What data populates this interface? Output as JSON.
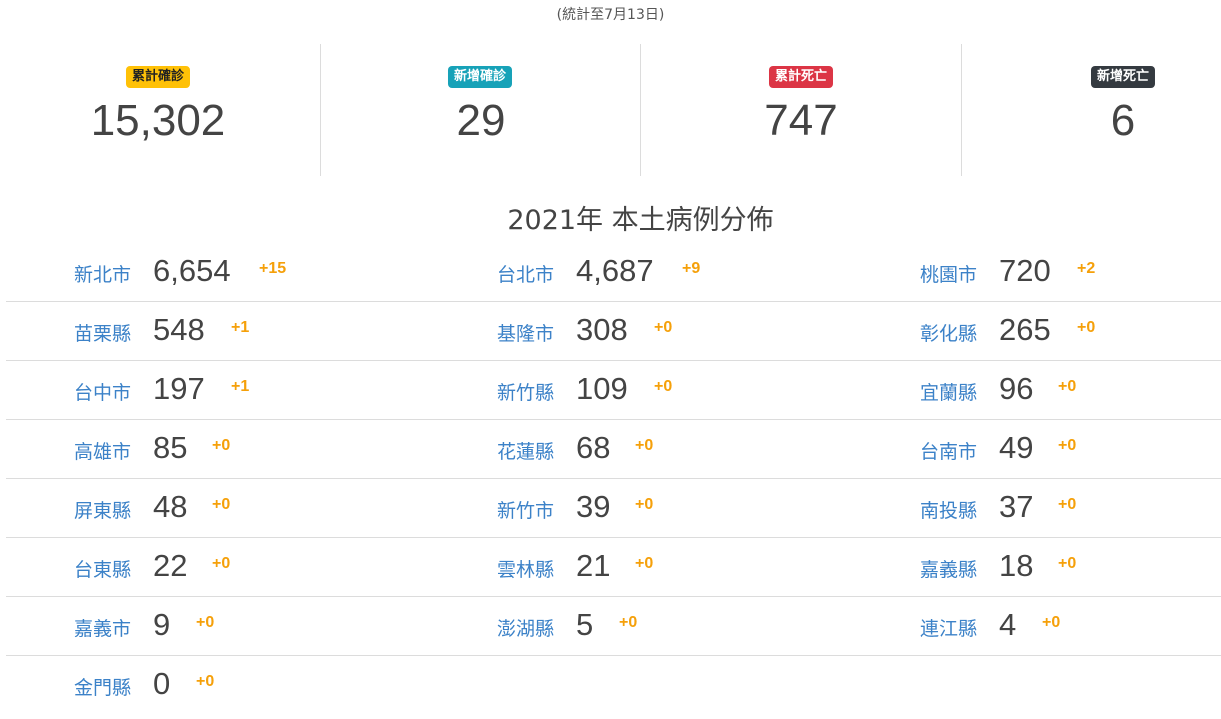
{
  "note": "(統計至7月13日)",
  "stats": [
    {
      "label": "累計確診",
      "value": "15,302",
      "badge_bg": "#ffc107",
      "badge_fg": "#222222"
    },
    {
      "label": "新增確診",
      "value": "29",
      "badge_bg": "#17a2b8",
      "badge_fg": "#ffffff"
    },
    {
      "label": "累計死亡",
      "value": "747",
      "badge_bg": "#dc3545",
      "badge_fg": "#ffffff"
    },
    {
      "label": "新增死亡",
      "value": "6",
      "badge_bg": "#343a40",
      "badge_fg": "#ffffff"
    }
  ],
  "section_title": "2021年 本土病例分佈",
  "colors": {
    "city_link": "#3c82c8",
    "increment": "#f5a00a",
    "divider": "#dcdcdc",
    "number": "#444444"
  },
  "cities": [
    [
      {
        "name": "新北市",
        "count": "6,654",
        "inc": "+15"
      },
      {
        "name": "台北市",
        "count": "4,687",
        "inc": "+9"
      },
      {
        "name": "桃園市",
        "count": "720",
        "inc": "+2"
      }
    ],
    [
      {
        "name": "苗栗縣",
        "count": "548",
        "inc": "+1"
      },
      {
        "name": "基隆市",
        "count": "308",
        "inc": "+0"
      },
      {
        "name": "彰化縣",
        "count": "265",
        "inc": "+0"
      }
    ],
    [
      {
        "name": "台中市",
        "count": "197",
        "inc": "+1"
      },
      {
        "name": "新竹縣",
        "count": "109",
        "inc": "+0"
      },
      {
        "name": "宜蘭縣",
        "count": "96",
        "inc": "+0"
      }
    ],
    [
      {
        "name": "高雄市",
        "count": "85",
        "inc": "+0"
      },
      {
        "name": "花蓮縣",
        "count": "68",
        "inc": "+0"
      },
      {
        "name": "台南市",
        "count": "49",
        "inc": "+0"
      }
    ],
    [
      {
        "name": "屏東縣",
        "count": "48",
        "inc": "+0"
      },
      {
        "name": "新竹市",
        "count": "39",
        "inc": "+0"
      },
      {
        "name": "南投縣",
        "count": "37",
        "inc": "+0"
      }
    ],
    [
      {
        "name": "台東縣",
        "count": "22",
        "inc": "+0"
      },
      {
        "name": "雲林縣",
        "count": "21",
        "inc": "+0"
      },
      {
        "name": "嘉義縣",
        "count": "18",
        "inc": "+0"
      }
    ],
    [
      {
        "name": "嘉義市",
        "count": "9",
        "inc": "+0"
      },
      {
        "name": "澎湖縣",
        "count": "5",
        "inc": "+0"
      },
      {
        "name": "連江縣",
        "count": "4",
        "inc": "+0"
      }
    ],
    [
      {
        "name": "金門縣",
        "count": "0",
        "inc": "+0"
      }
    ]
  ]
}
